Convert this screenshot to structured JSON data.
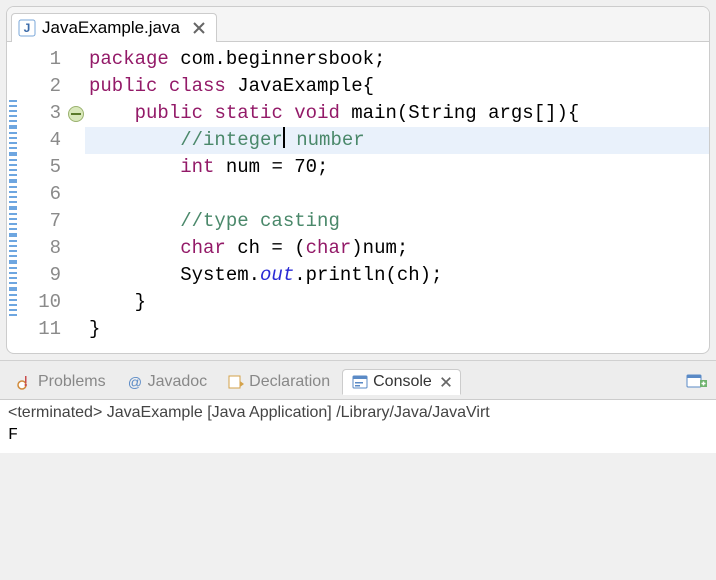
{
  "editor": {
    "tab_filename": "JavaExample.java",
    "active_line": 4,
    "fold_line": 3,
    "range_marker_start": 3,
    "range_marker_end": 10,
    "lines": [
      {
        "n": 1,
        "segments": [
          {
            "cls": "kw",
            "t": "package"
          },
          {
            "cls": "plain",
            "t": " com.beginnersbook;"
          }
        ]
      },
      {
        "n": 2,
        "segments": [
          {
            "cls": "kw",
            "t": "public"
          },
          {
            "cls": "plain",
            "t": " "
          },
          {
            "cls": "kw",
            "t": "class"
          },
          {
            "cls": "plain",
            "t": " JavaExample{"
          }
        ]
      },
      {
        "n": 3,
        "segments": [
          {
            "cls": "plain",
            "t": "    "
          },
          {
            "cls": "kw",
            "t": "public"
          },
          {
            "cls": "plain",
            "t": " "
          },
          {
            "cls": "kw",
            "t": "static"
          },
          {
            "cls": "plain",
            "t": " "
          },
          {
            "cls": "kw",
            "t": "void"
          },
          {
            "cls": "plain",
            "t": " main(String args[]){"
          }
        ]
      },
      {
        "n": 4,
        "segments": [
          {
            "cls": "plain",
            "t": "        "
          },
          {
            "cls": "comment",
            "t": "//integer"
          },
          {
            "cls": "caret",
            "t": ""
          },
          {
            "cls": "comment",
            "t": " number"
          }
        ]
      },
      {
        "n": 5,
        "segments": [
          {
            "cls": "plain",
            "t": "        "
          },
          {
            "cls": "kw",
            "t": "int"
          },
          {
            "cls": "plain",
            "t": " num = 70;"
          }
        ]
      },
      {
        "n": 6,
        "segments": [
          {
            "cls": "plain",
            "t": "        "
          }
        ]
      },
      {
        "n": 7,
        "segments": [
          {
            "cls": "plain",
            "t": "        "
          },
          {
            "cls": "comment",
            "t": "//type casting"
          }
        ]
      },
      {
        "n": 8,
        "segments": [
          {
            "cls": "plain",
            "t": "        "
          },
          {
            "cls": "kw",
            "t": "char"
          },
          {
            "cls": "plain",
            "t": " ch = ("
          },
          {
            "cls": "kw",
            "t": "char"
          },
          {
            "cls": "plain",
            "t": ")num;"
          }
        ]
      },
      {
        "n": 9,
        "segments": [
          {
            "cls": "plain",
            "t": "        System."
          },
          {
            "cls": "field-ital",
            "t": "out"
          },
          {
            "cls": "plain",
            "t": ".println(ch);"
          }
        ]
      },
      {
        "n": 10,
        "segments": [
          {
            "cls": "plain",
            "t": "    }"
          }
        ]
      },
      {
        "n": 11,
        "segments": [
          {
            "cls": "plain",
            "t": "}"
          }
        ]
      }
    ]
  },
  "views": {
    "tabs": [
      {
        "id": "problems",
        "label": "Problems",
        "active": false
      },
      {
        "id": "javadoc",
        "label": "Javadoc",
        "active": false
      },
      {
        "id": "declaration",
        "label": "Declaration",
        "active": false
      },
      {
        "id": "console",
        "label": "Console",
        "active": true
      }
    ]
  },
  "console": {
    "header": "<terminated> JavaExample [Java Application] /Library/Java/JavaVirt",
    "output": "F"
  }
}
